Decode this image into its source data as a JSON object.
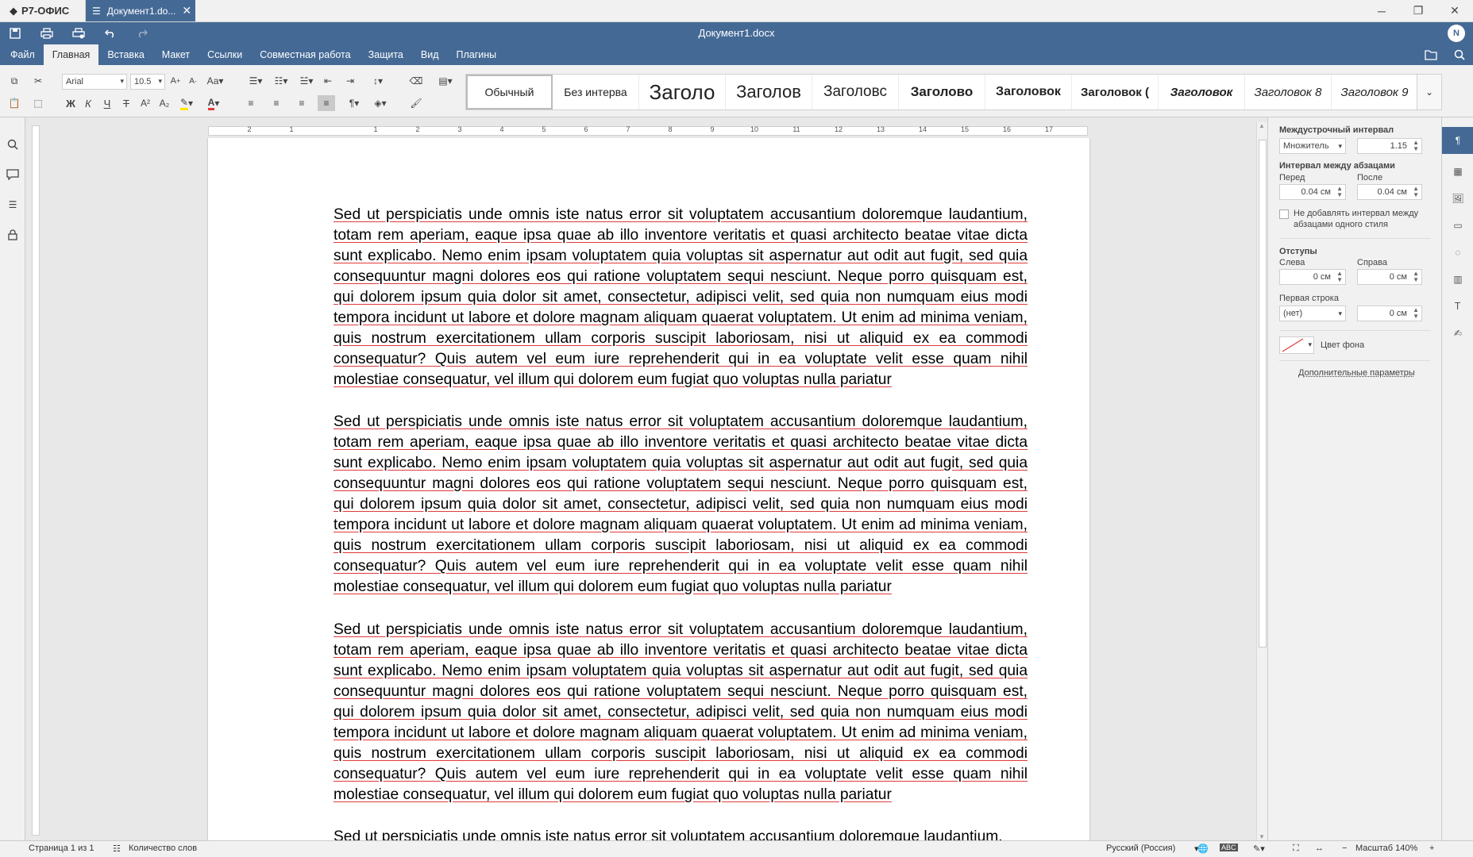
{
  "app": {
    "brand": "Р7-ОФИС",
    "tab_title": "Документ1.do...",
    "doc_title": "Документ1.docx",
    "user_initial": "N"
  },
  "menu": {
    "tabs": [
      "Файл",
      "Главная",
      "Вставка",
      "Макет",
      "Ссылки",
      "Совместная работа",
      "Защита",
      "Вид",
      "Плагины"
    ],
    "active": "Главная"
  },
  "toolbar": {
    "font_name": "Arial",
    "font_size": "10.5",
    "case_label": "Аа"
  },
  "styles": [
    "Обычный",
    "Без интерва",
    "Заголо",
    "Заголов",
    "Заголовс",
    "Заголово",
    "Заголовок",
    "Заголовок (",
    "Заголовок",
    "Заголовок 8",
    "Заголовок 9"
  ],
  "ruler": {
    "ticks": [
      "2",
      "1",
      "1",
      "2",
      "3",
      "4",
      "5",
      "6",
      "7",
      "8",
      "9",
      "10",
      "11",
      "12",
      "13",
      "14",
      "15",
      "16",
      "17"
    ]
  },
  "document": {
    "paragraph_lines": [
      "Sed ut perspiciatis unde omnis iste natus error sit voluptatem accusantium doloremque laudantium,",
      "totam rem aperiam, eaque ipsa quae ab illo inventore veritatis et quasi architecto beatae vitae dicta",
      "sunt explicabo. Nemo enim ipsam voluptatem quia voluptas sit aspernatur aut odit aut fugit, sed quia",
      "consequuntur magni dolores eos qui ratione voluptatem sequi nesciunt. Neque porro quisquam est,",
      "qui dolorem ipsum quia dolor sit amet, consectetur, adipisci velit, sed quia non numquam eius modi",
      "tempora incidunt ut labore et dolore magnam aliquam quaerat voluptatem. Ut enim ad minima veniam,",
      "quis nostrum exercitationem ullam corporis suscipit laboriosam, nisi ut aliquid ex ea commodi",
      "consequatur? Quis autem vel eum iure reprehenderit qui in ea voluptate velit esse quam nihil",
      "molestiae consequatur, vel illum qui dolorem eum fugiat quo voluptas nulla pariatur"
    ],
    "partial_line": "Sed ut perspiciatis unde omnis iste natus error sit voluptatem accusantium doloremque laudantium,"
  },
  "panel": {
    "line_spacing_title": "Междустрочный интервал",
    "line_spacing_mode": "Множитель",
    "line_spacing_value": "1.15",
    "para_spacing_title": "Интервал между абзацами",
    "before_label": "Перед",
    "after_label": "После",
    "before_value": "0.04 см",
    "after_value": "0.04 см",
    "no_spacing_label": "Не добавлять интервал между абзацами одного стиля",
    "indents_title": "Отступы",
    "left_label": "Слева",
    "right_label": "Справа",
    "left_value": "0 см",
    "right_value": "0 см",
    "first_line_label": "Первая строка",
    "first_line_mode": "(нет)",
    "first_line_value": "0 см",
    "bg_color_label": "Цвет фона",
    "advanced_link": "Дополнительные параметры"
  },
  "status": {
    "page": "Страница 1 из 1",
    "word_count": "Количество слов",
    "language": "Русский (Россия)",
    "zoom": "Масштаб 140%"
  },
  "colors": {
    "accent": "#446995",
    "spell_underline": "#e03a3a"
  }
}
